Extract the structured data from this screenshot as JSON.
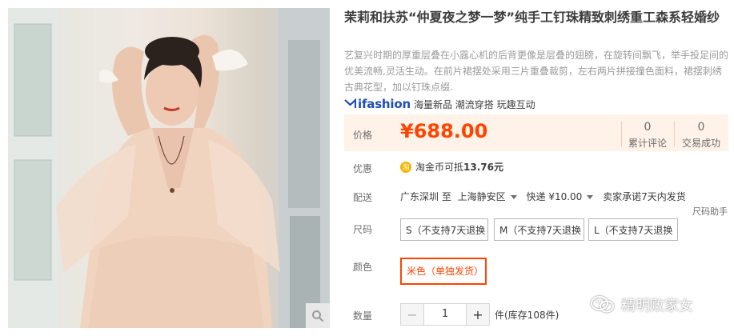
{
  "product": {
    "title": "茉莉和扶苏“仲夏夜之梦一梦”纯手工钉珠精致刺绣重工森系轻婚纱",
    "subtitle": "艺复兴时期的厚重层叠在小露心机的后背更像是层叠的翅膀，在旋转间飘飞，举手投足间的优美流畅,灵活生动。在前片裙摆处采用三片重叠裁剪，左右两片拼接撞色面料，裙摆刺绣古典花型，加以钉珠点缀."
  },
  "brand": {
    "logo": "ifashion",
    "tags": "海量新品 潮流穿搭 玩趣互动"
  },
  "price": {
    "label": "价格",
    "value": "¥688.00"
  },
  "stats": [
    {
      "count": "0",
      "label": "累计评论"
    },
    {
      "count": "0",
      "label": "交易成功"
    }
  ],
  "promo": {
    "label": "优惠",
    "coin_icon": "淘",
    "text_prefix": "淘金币可抵",
    "amount": "13.76元"
  },
  "shipping": {
    "label": "配送",
    "from": "广东深圳 至",
    "to": "上海静安区",
    "method": "快递 ¥10.00",
    "promise": "卖家承诺7天内发货"
  },
  "size": {
    "label": "尺码",
    "help": "尺码助手",
    "options": [
      "S（不支持7天退换",
      "M（不支持7天退换",
      "L（不支持7天退换"
    ]
  },
  "color": {
    "label": "颜色",
    "options": [
      "米色（单独发货）"
    ]
  },
  "quantity": {
    "label": "数量",
    "minus": "−",
    "value": "1",
    "plus": "+",
    "stock": "件(库存108件)"
  },
  "watermark": {
    "text": "精明败家女"
  },
  "icons": {
    "zoom": "magnifier-icon",
    "wechat": "wechat-icon"
  }
}
